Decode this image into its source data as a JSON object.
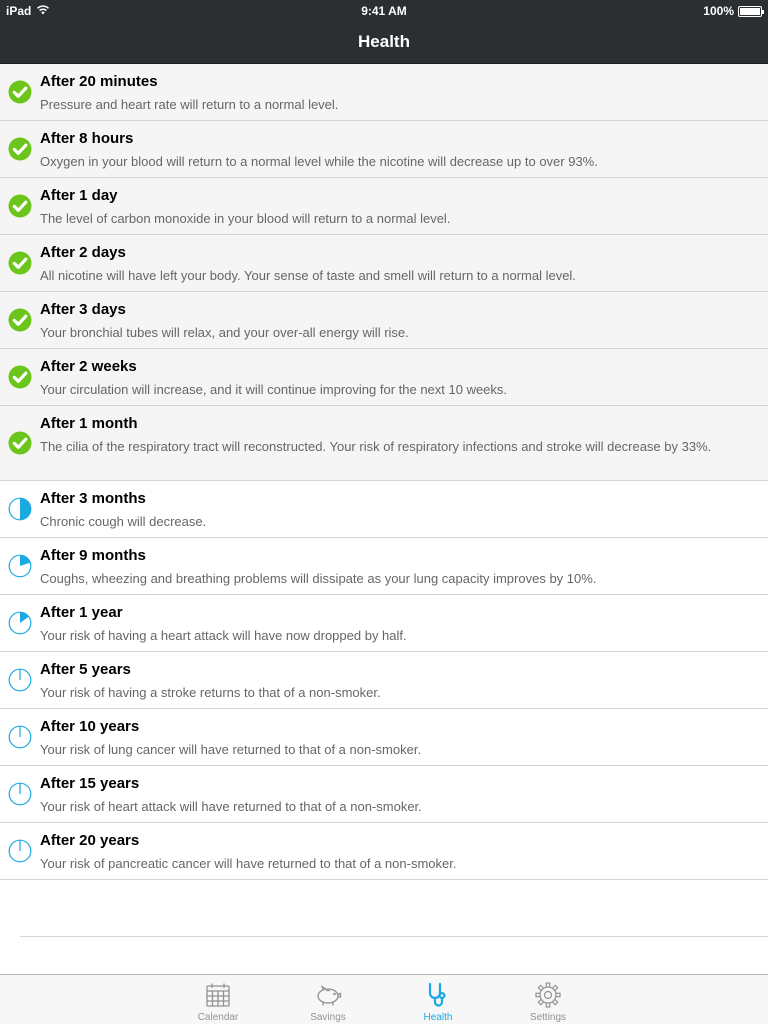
{
  "status_bar": {
    "device": "iPad",
    "time": "9:41 AM",
    "battery": "100%"
  },
  "nav": {
    "title": "Health"
  },
  "milestones": [
    {
      "title": "After 20 minutes",
      "desc": "Pressure and heart rate will return to a normal level.",
      "progress": 1
    },
    {
      "title": "After 8 hours",
      "desc": "Oxygen in your blood will return to a normal level while the nicotine will decrease up to over 93%.",
      "progress": 1
    },
    {
      "title": "After 1 day",
      "desc": "The level of carbon monoxide in your blood will return to a normal level.",
      "progress": 1
    },
    {
      "title": "After 2 days",
      "desc": "All nicotine will have left your body. Your sense of taste and smell will return to a normal level.",
      "progress": 1
    },
    {
      "title": "After 3 days",
      "desc": "Your bronchial tubes will relax, and your over-all energy will rise.",
      "progress": 1
    },
    {
      "title": "After 2 weeks",
      "desc": "Your circulation will increase, and it will continue improving for the next 10 weeks.",
      "progress": 1
    },
    {
      "title": "After 1 month",
      "desc": "The cilia of the respiratory tract will reconstructed. Your risk of respiratory infections and stroke will decrease by 33%.",
      "progress": 1
    },
    {
      "title": "After 3 months",
      "desc": "Chronic cough will decrease.",
      "progress": 0.5
    },
    {
      "title": "After 9 months",
      "desc": "Coughs, wheezing and breathing problems will dissipate as your lung capacity improves by 10%.",
      "progress": 0.2
    },
    {
      "title": "After 1 year",
      "desc": "Your risk of having a heart attack will have now dropped by half.",
      "progress": 0.15
    },
    {
      "title": "After 5 years",
      "desc": "Your risk of having a stroke returns to that of a non-smoker.",
      "progress": 0.02
    },
    {
      "title": "After 10 years",
      "desc": "Your risk of lung cancer will have returned to that of a non-smoker.",
      "progress": 0.01
    },
    {
      "title": "After 15 years",
      "desc": "Your risk of heart attack will have returned to that of a non-smoker.",
      "progress": 0.01
    },
    {
      "title": "After 20 years",
      "desc": "Your risk of pancreatic cancer will have returned to that of a non-smoker.",
      "progress": 0.005
    }
  ],
  "tabs": [
    {
      "label": "Calendar",
      "icon": "calendar-icon",
      "active": false
    },
    {
      "label": "Savings",
      "icon": "piggy-bank-icon",
      "active": false
    },
    {
      "label": "Health",
      "icon": "stethoscope-icon",
      "active": true
    },
    {
      "label": "Settings",
      "icon": "gear-icon",
      "active": false
    }
  ],
  "colors": {
    "bar": "#2b2f32",
    "done": "#6cc51a",
    "progress": "#1ba9e1",
    "inactive_tab": "#929292"
  }
}
